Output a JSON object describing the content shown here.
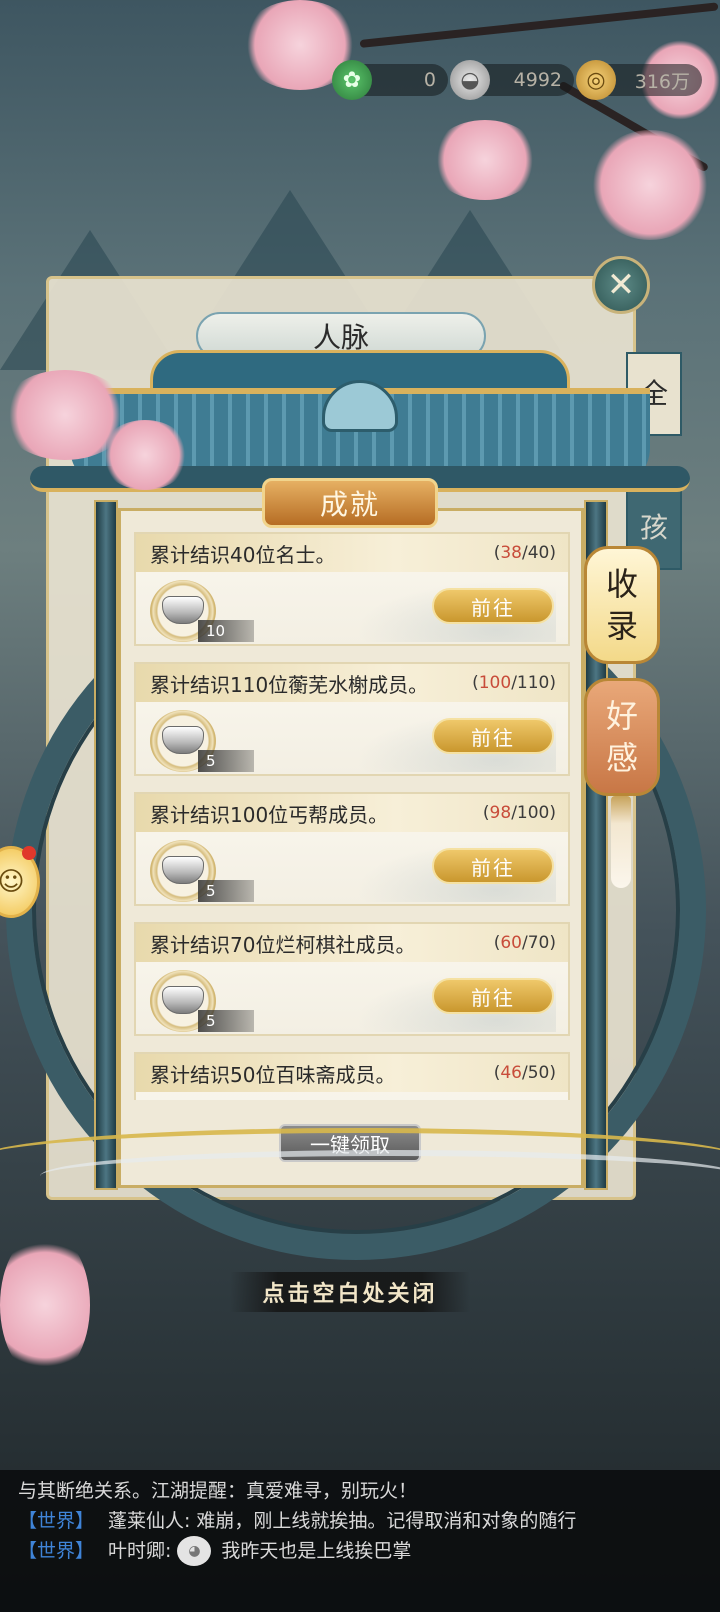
{
  "currency": [
    {
      "icon": "jade-frog-icon",
      "value": "0"
    },
    {
      "icon": "silver-ingot-icon",
      "value": "4992"
    },
    {
      "icon": "gold-coin-icon",
      "value": "316万"
    }
  ],
  "outer": {
    "title": "人脉",
    "tabs": [
      "全",
      "孩"
    ]
  },
  "achievements": {
    "title": "成就",
    "items": [
      {
        "text": "累计结识40位名士。",
        "current": "38",
        "total": "/40)",
        "reward_count": "10",
        "action": "前往"
      },
      {
        "text": "累计结识110位蘅芜水榭成员。",
        "current": "100",
        "total": "/110)",
        "reward_count": "5",
        "action": "前往"
      },
      {
        "text": "累计结识100位丐帮成员。",
        "current": "98",
        "total": "/100)",
        "reward_count": "5",
        "action": "前往"
      },
      {
        "text": "累计结识70位烂柯棋社成员。",
        "current": "60",
        "total": "/70)",
        "reward_count": "5",
        "action": "前往"
      },
      {
        "text": "累计结识50位百味斋成员。",
        "current": "46",
        "total": "/50)",
        "reward_count": "",
        "action": ""
      }
    ],
    "claim_all": "一键领取"
  },
  "side_tabs": {
    "collection": [
      "收",
      "录"
    ],
    "favor": [
      "好",
      "感"
    ]
  },
  "hint": "点击空白处关闭",
  "chat": {
    "lines": [
      {
        "channel": "",
        "speaker": "",
        "text": "与其断绝关系。江湖提醒：真爱难寻，别玩火！"
      },
      {
        "channel": "【世界】",
        "speaker": "蓬莱仙人:",
        "text": "难崩，刚上线就挨抽。记得取消和对象的随行"
      },
      {
        "channel": "【世界】",
        "speaker": "叶时卿:",
        "text": "我昨天也是上线挨巴掌"
      }
    ]
  },
  "colors": {
    "accent_gold": "#d9b25d",
    "frame_teal": "#3b5c66",
    "progress_red": "#c84c3a",
    "chat_channel_blue": "#3f84d8"
  }
}
